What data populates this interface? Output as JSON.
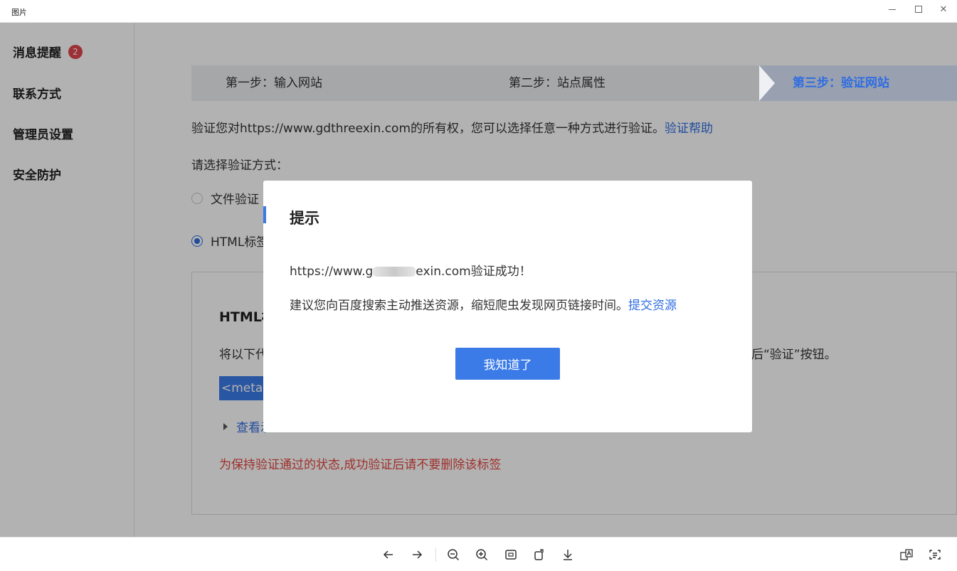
{
  "window": {
    "title": "图片"
  },
  "sidebar": {
    "items": [
      {
        "label": "消息提醒",
        "badge": "2"
      },
      {
        "label": "联系方式"
      },
      {
        "label": "管理员设置"
      },
      {
        "label": "安全防护"
      }
    ]
  },
  "steps": {
    "step1": "第一步：输入网站",
    "step2": "第二步：站点属性",
    "step3": "第三步：验证网站"
  },
  "main": {
    "desc": "验证您对https://www.gdthreexin.com的所有权，您可以选择任意一种方式进行验证。",
    "help_link": "验证帮助",
    "choose_label": "请选择验证方式：",
    "options": [
      {
        "label": "文件验证",
        "checked": false
      },
      {
        "label": "HTML标签",
        "checked": true
      }
    ],
    "box": {
      "title": "HTML标",
      "desc_start": "将以下代",
      "desc_end": "后“验证”按钮。",
      "meta_code": "<meta n",
      "view_example": "查看示",
      "warning": "为保持验证通过的状态,成功验证后请不要删除该标签"
    }
  },
  "modal": {
    "title": "提示",
    "success_prefix": "https://www.g",
    "success_suffix": "exin.com验证成功！",
    "suggest": "建议您向百度搜索主动推送资源，缩短爬虫发现网页链接时间。",
    "submit_link": "提交资源",
    "ok_button": "我知道了"
  },
  "toolbar": {
    "icons": [
      "arrow-left-icon",
      "arrow-right-icon",
      "zoom-out-icon",
      "zoom-in-icon",
      "fit-screen-icon",
      "rotate-icon",
      "download-icon",
      "translate-icon",
      "text-recognition-icon"
    ]
  }
}
